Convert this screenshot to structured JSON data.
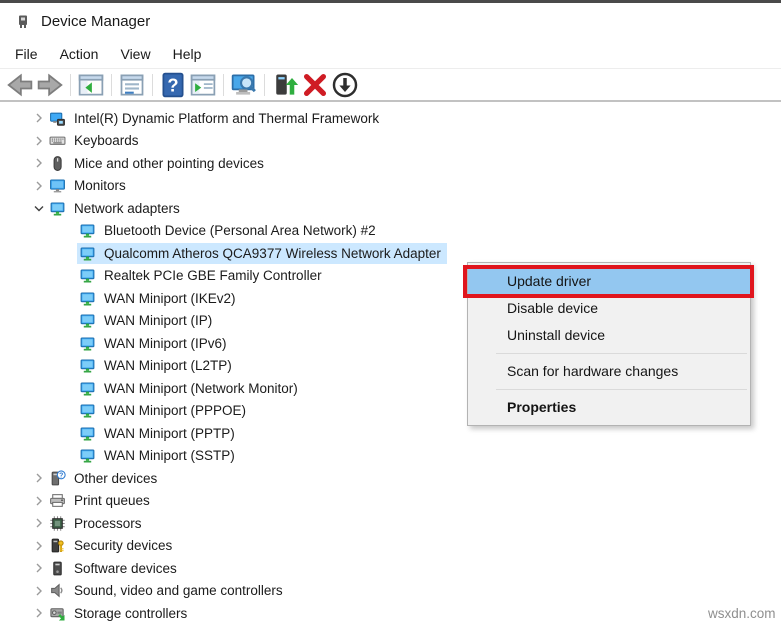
{
  "window": {
    "title": "Device Manager",
    "title_icon": "device-manager-icon"
  },
  "menu_bar": {
    "items": [
      {
        "label": "File"
      },
      {
        "label": "Action"
      },
      {
        "label": "View"
      },
      {
        "label": "Help"
      }
    ]
  },
  "toolbar": {
    "buttons": [
      {
        "name": "back",
        "icon": "arrow-left-icon"
      },
      {
        "name": "forward",
        "icon": "arrow-right-icon"
      },
      {
        "type": "separator"
      },
      {
        "name": "show-hide-console-tree",
        "icon": "console-tree-icon"
      },
      {
        "type": "separator"
      },
      {
        "name": "properties-window",
        "icon": "properties-window-icon"
      },
      {
        "type": "separator"
      },
      {
        "name": "help",
        "icon": "help-icon"
      },
      {
        "name": "show-action-pane",
        "icon": "action-pane-icon"
      },
      {
        "type": "separator"
      },
      {
        "name": "scan-for-hardware-changes",
        "icon": "scan-hardware-icon"
      },
      {
        "type": "separator"
      },
      {
        "name": "update-driver",
        "icon": "update-driver-arrow-icon"
      },
      {
        "name": "uninstall-device",
        "icon": "red-x-icon"
      },
      {
        "name": "disable-device",
        "icon": "disable-down-arrow-icon"
      }
    ]
  },
  "tree": {
    "items": [
      {
        "label": "Intel(R) Dynamic Platform and Thermal Framework",
        "level": 0,
        "chevron": "collapsed",
        "icon": "chip-monitor-icon"
      },
      {
        "label": "Keyboards",
        "level": 0,
        "chevron": "collapsed",
        "icon": "keyboard-icon"
      },
      {
        "label": "Mice and other pointing devices",
        "level": 0,
        "chevron": "collapsed",
        "icon": "mouse-icon"
      },
      {
        "label": "Monitors",
        "level": 0,
        "chevron": "collapsed",
        "icon": "monitor-icon"
      },
      {
        "label": "Network adapters",
        "level": 0,
        "chevron": "expanded",
        "icon": "network-adapter-icon"
      },
      {
        "label": "Bluetooth Device (Personal Area Network) #2",
        "level": 1,
        "icon": "network-adapter-icon"
      },
      {
        "label": "Qualcomm Atheros QCA9377 Wireless Network Adapter",
        "level": 1,
        "icon": "network-adapter-icon",
        "selected": true
      },
      {
        "label": "Realtek PCIe GBE Family Controller",
        "level": 1,
        "icon": "network-adapter-icon"
      },
      {
        "label": "WAN Miniport (IKEv2)",
        "level": 1,
        "icon": "network-adapter-icon"
      },
      {
        "label": "WAN Miniport (IP)",
        "level": 1,
        "icon": "network-adapter-icon"
      },
      {
        "label": "WAN Miniport (IPv6)",
        "level": 1,
        "icon": "network-adapter-icon"
      },
      {
        "label": "WAN Miniport (L2TP)",
        "level": 1,
        "icon": "network-adapter-icon"
      },
      {
        "label": "WAN Miniport (Network Monitor)",
        "level": 1,
        "icon": "network-adapter-icon"
      },
      {
        "label": "WAN Miniport (PPPOE)",
        "level": 1,
        "icon": "network-adapter-icon"
      },
      {
        "label": "WAN Miniport (PPTP)",
        "level": 1,
        "icon": "network-adapter-icon"
      },
      {
        "label": "WAN Miniport (SSTP)",
        "level": 1,
        "icon": "network-adapter-icon"
      },
      {
        "label": "Other devices",
        "level": 0,
        "chevron": "collapsed",
        "icon": "other-device-icon"
      },
      {
        "label": "Print queues",
        "level": 0,
        "chevron": "collapsed",
        "icon": "printer-icon"
      },
      {
        "label": "Processors",
        "level": 0,
        "chevron": "collapsed",
        "icon": "processor-icon"
      },
      {
        "label": "Security devices",
        "level": 0,
        "chevron": "collapsed",
        "icon": "security-device-icon"
      },
      {
        "label": "Software devices",
        "level": 0,
        "chevron": "collapsed",
        "icon": "software-device-icon"
      },
      {
        "label": "Sound, video and game controllers",
        "level": 0,
        "chevron": "collapsed",
        "icon": "speaker-icon"
      },
      {
        "label": "Storage controllers",
        "level": 0,
        "chevron": "collapsed",
        "icon": "storage-controller-icon"
      }
    ]
  },
  "context_menu": {
    "items": [
      {
        "label": "Update driver",
        "highlighted": true,
        "annotated": true
      },
      {
        "label": "Disable device"
      },
      {
        "label": "Uninstall device"
      },
      {
        "type": "separator"
      },
      {
        "label": "Scan for hardware changes"
      },
      {
        "type": "separator"
      },
      {
        "label": "Properties",
        "bold": true
      }
    ]
  },
  "watermark": "wsxdn.com",
  "colors": {
    "selection_highlight": "#cce8ff",
    "menu_highlight": "#93c7f0",
    "annotation_red": "#e0151d"
  }
}
